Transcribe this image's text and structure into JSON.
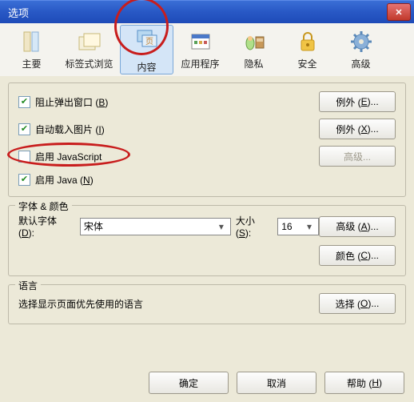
{
  "window": {
    "title": "选项"
  },
  "toolbar": {
    "main": "主要",
    "tab": "标签式浏览",
    "content": "内容",
    "apps": "应用程序",
    "privacy": "隐私",
    "security": "安全",
    "advanced": "高级"
  },
  "content_section": {
    "block_popup": "阻止弹出窗口 (B)",
    "autoload_images": "自动载入图片 (I)",
    "enable_js": "启用 JavaScript",
    "enable_java": "启用 Java (N)",
    "btn_exception_e": "例外 (E)...",
    "btn_exception_x": "例外 (X)...",
    "btn_advanced": "高级..."
  },
  "fonts": {
    "legend": "字体 & 颜色",
    "defaultfont_label": "默认字体 (D):",
    "font_value": "宋体",
    "size_label": "大小 (S):",
    "size_value": "16",
    "btn_advanced": "高级 (A)...",
    "btn_color": "颜色 (C)..."
  },
  "lang": {
    "legend": "语言",
    "desc": "选择显示页面优先使用的语言",
    "btn_choose": "选择 (O)..."
  },
  "buttons": {
    "ok": "确定",
    "cancel": "取消",
    "help": "帮助 (H)"
  }
}
